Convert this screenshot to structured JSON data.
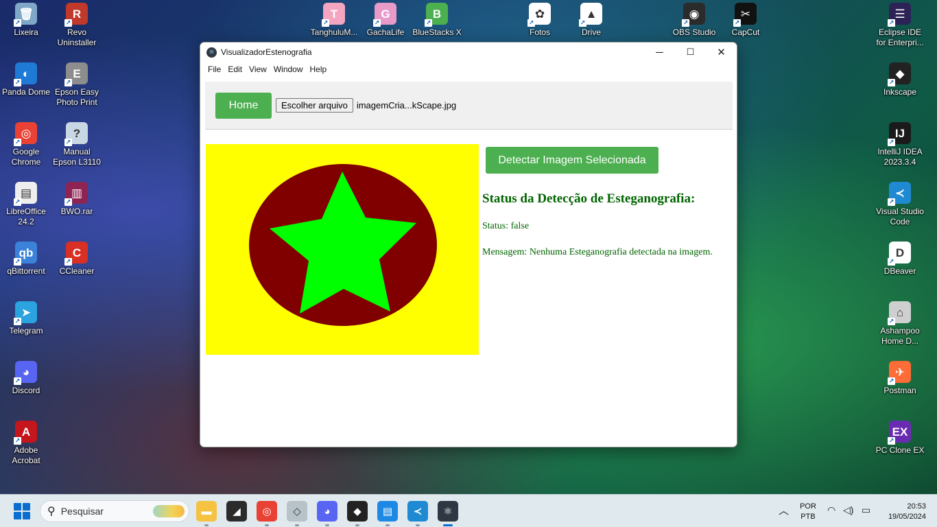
{
  "desktop": {
    "icons": [
      {
        "label": "Lixeira",
        "icon": "recycle-bin-icon",
        "color": "#7fa8c8",
        "glyph": "🗑"
      },
      {
        "label": "Revo Uninstaller",
        "icon": "revo-uninstaller-icon",
        "color": "#c0392b",
        "glyph": "R"
      },
      {
        "label": "TanghuluM...",
        "icon": "tanghulu-icon",
        "color": "#f4a6c0",
        "glyph": "T"
      },
      {
        "label": "GachaLife",
        "icon": "gachalife-icon",
        "color": "#e89ac9",
        "glyph": "G"
      },
      {
        "label": "BlueStacks X",
        "icon": "bluestacks-icon",
        "color": "#4caf50",
        "glyph": "B"
      },
      {
        "label": "Fotos",
        "icon": "photos-icon",
        "color": "#ffffff",
        "glyph": "✿"
      },
      {
        "label": "Drive",
        "icon": "google-drive-icon",
        "color": "#ffffff",
        "glyph": "▲"
      },
      {
        "label": "OBS Studio",
        "icon": "obs-studio-icon",
        "color": "#2b2b2b",
        "glyph": "◉"
      },
      {
        "label": "CapCut",
        "icon": "capcut-icon",
        "color": "#111111",
        "glyph": "✂"
      },
      {
        "label": "Eclipse IDE for Enterpri...",
        "icon": "eclipse-icon",
        "color": "#2c2255",
        "glyph": "☰"
      },
      {
        "label": "Panda Dome",
        "icon": "panda-dome-icon",
        "color": "#1f7ad6",
        "glyph": "◐"
      },
      {
        "label": "Epson Easy Photo Print",
        "icon": "epson-photo-print-icon",
        "color": "#8d8d8d",
        "glyph": "E"
      },
      {
        "label": "Inkscape",
        "icon": "inkscape-icon",
        "color": "#222222",
        "glyph": "◆"
      },
      {
        "label": "Google Chrome",
        "icon": "chrome-icon",
        "color": "#e94235",
        "glyph": "◎"
      },
      {
        "label": "Manual Epson L3110",
        "icon": "manual-epson-icon",
        "color": "#c9d6e3",
        "glyph": "?"
      },
      {
        "label": "IntelliJ IDEA 2023.3.4",
        "icon": "intellij-icon",
        "color": "#1a1a1a",
        "glyph": "IJ"
      },
      {
        "label": "LibreOffice 24.2",
        "icon": "libreoffice-icon",
        "color": "#eeeeee",
        "glyph": "▤"
      },
      {
        "label": "BWO.rar",
        "icon": "winrar-icon",
        "color": "#8e2454",
        "glyph": "▥"
      },
      {
        "label": "Visual Studio Code",
        "icon": "vscode-icon",
        "color": "#1f8ad2",
        "glyph": "≺"
      },
      {
        "label": "qBittorrent",
        "icon": "qbittorrent-icon",
        "color": "#3b82d9",
        "glyph": "qb"
      },
      {
        "label": "CCleaner",
        "icon": "ccleaner-icon",
        "color": "#d93025",
        "glyph": "C"
      },
      {
        "label": "DBeaver",
        "icon": "dbeaver-icon",
        "color": "#ffffff",
        "glyph": "D"
      },
      {
        "label": "Telegram",
        "icon": "telegram-icon",
        "color": "#2aa3df",
        "glyph": "➤"
      },
      {
        "label": "Ashampoo Home D...",
        "icon": "ashampoo-icon",
        "color": "#cfcfcf",
        "glyph": "⌂"
      },
      {
        "label": "Discord",
        "icon": "discord-icon",
        "color": "#5865f2",
        "glyph": "◕"
      },
      {
        "label": "Postman",
        "icon": "postman-icon",
        "color": "#ff6c37",
        "glyph": "✈"
      },
      {
        "label": "Adobe Acrobat",
        "icon": "adobe-acrobat-icon",
        "color": "#c4161c",
        "glyph": "A"
      },
      {
        "label": "PC Clone EX",
        "icon": "pc-clone-ex-icon",
        "color": "#6a2bb3",
        "glyph": "EX"
      }
    ]
  },
  "window": {
    "title": "VisualizadorEstenografia",
    "controls": {
      "minimize": "─",
      "maximize": "☐",
      "close": "✕"
    },
    "menu": [
      "File",
      "Edit",
      "View",
      "Window",
      "Help"
    ]
  },
  "app": {
    "home_label": "Home",
    "file_button_label": "Escolher arquivo",
    "file_name": "imagemCria...kScape.jpg",
    "detect_label": "Detectar Imagem Selecionada",
    "status_title": "Status da Detecção de Esteganografia:",
    "status_line": "Status: false",
    "message_line": "Mensagem: Nenhuma Esteganografia detectada na imagem.",
    "image_colors": {
      "background": "#ffff00",
      "ellipse": "#800000",
      "star": "#00ff00"
    }
  },
  "taskbar": {
    "search_placeholder": "Pesquisar",
    "apps": [
      {
        "name": "file-explorer-taskbar-icon",
        "glyph": "▬",
        "color": "#f5c242",
        "state": "running"
      },
      {
        "name": "sticky-notes-taskbar-icon",
        "glyph": "◢",
        "color": "#2b2b2b",
        "state": ""
      },
      {
        "name": "chrome-taskbar-icon",
        "glyph": "◎",
        "color": "#e94235",
        "state": "running"
      },
      {
        "name": "roblox-taskbar-icon",
        "glyph": "◇",
        "color": "#b7c3c9",
        "state": "running"
      },
      {
        "name": "discord-taskbar-icon",
        "glyph": "◕",
        "color": "#5865f2",
        "state": "running"
      },
      {
        "name": "inkscape-taskbar-icon",
        "glyph": "◆",
        "color": "#222222",
        "state": "running"
      },
      {
        "name": "notepad-taskbar-icon",
        "glyph": "▤",
        "color": "#1e88e5",
        "state": "running"
      },
      {
        "name": "vscode-taskbar-icon",
        "glyph": "≺",
        "color": "#1f8ad2",
        "state": "running"
      },
      {
        "name": "electron-app-taskbar-icon",
        "glyph": "⚛",
        "color": "#2f3742",
        "state": "active"
      }
    ],
    "lang_top": "POR",
    "lang_bottom": "PTB",
    "time": "20:53",
    "date": "19/05/2024"
  }
}
